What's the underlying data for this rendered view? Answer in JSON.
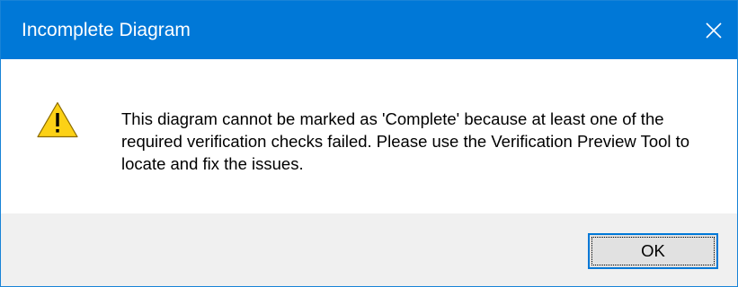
{
  "dialog": {
    "title": "Incomplete Diagram",
    "close_icon": "close-icon",
    "warning_icon": "warning-icon",
    "message": "This diagram cannot be marked as 'Complete' because at least one of the required verification checks failed. Please use the Verification Preview Tool to locate and fix the issues.",
    "ok_label": "OK"
  },
  "colors": {
    "titlebar": "#0078d7",
    "footer": "#f0f0f0",
    "warning_fill": "#fcd116"
  }
}
